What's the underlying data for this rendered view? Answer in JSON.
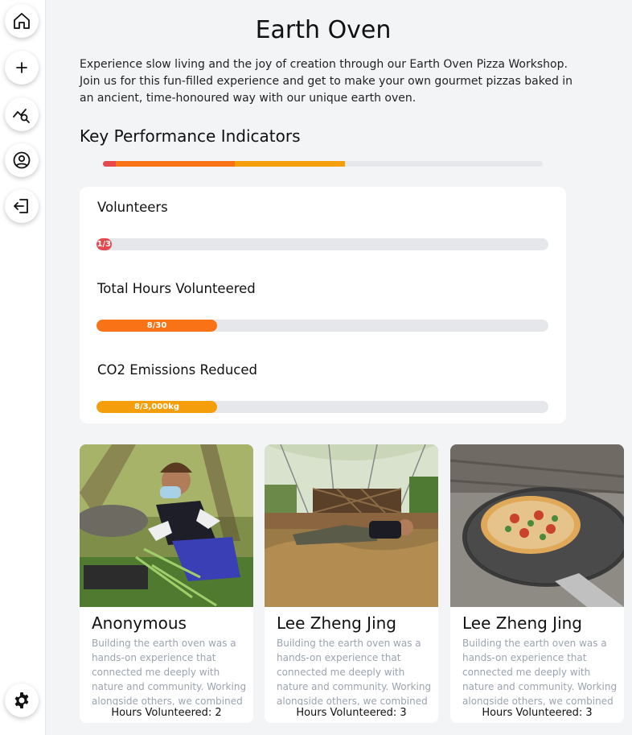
{
  "sidebar": {
    "items": [
      {
        "icon": "home-icon"
      },
      {
        "icon": "plus-icon"
      },
      {
        "icon": "analytics-search-icon"
      },
      {
        "icon": "user-circle-icon"
      },
      {
        "icon": "logout-icon"
      }
    ],
    "bottom": {
      "icon": "gear-icon"
    }
  },
  "page": {
    "title": "Earth Oven",
    "description": "Experience slow living and the joy of creation through our Earth Oven Pizza Workshop. Join us for this fun-filled experience and get to make your own gourmet pizzas baked in an ancient, time-honoured way with our unique earth oven."
  },
  "kpi": {
    "heading": "Key Performance Indicators",
    "overall_segments": [
      {
        "fraction": 0.03,
        "color": "#e5484d"
      },
      {
        "fraction": 0.27,
        "color": "#f97316"
      },
      {
        "fraction": 0.25,
        "color": "#f59e0b"
      }
    ],
    "items": [
      {
        "label": "Volunteers",
        "value_text": "1/3",
        "fraction": 0.0333,
        "color": "#e5484d"
      },
      {
        "label": "Total Hours Volunteered",
        "value_text": "8/30",
        "fraction": 0.267,
        "color": "#f97316"
      },
      {
        "label": "CO2 Emissions Reduced",
        "value_text": "8/3,000kg",
        "fraction": 0.267,
        "color": "#f59e0b"
      }
    ]
  },
  "stories": [
    {
      "name": "Anonymous",
      "text": "Building the earth oven was a hands-on experience that connected me deeply with nature and community. Working alongside others, we combined ancient",
      "hours": "Hours Volunteered: 2",
      "image": "woman-gardening-photo"
    },
    {
      "name": "Lee Zheng Jing",
      "text": "Building the earth oven was a hands-on experience that connected me deeply with nature and community. Working alongside others, we combined ancient",
      "hours": "Hours Volunteered: 3",
      "image": "man-lying-on-straw-photo"
    },
    {
      "name": "Lee Zheng Jing",
      "text": "Building the earth oven was a hands-on experience that connected me deeply with nature and community. Working alongside others, we combined ancient",
      "hours": "Hours Volunteered: 3",
      "image": "pizza-on-peel-photo"
    }
  ]
}
